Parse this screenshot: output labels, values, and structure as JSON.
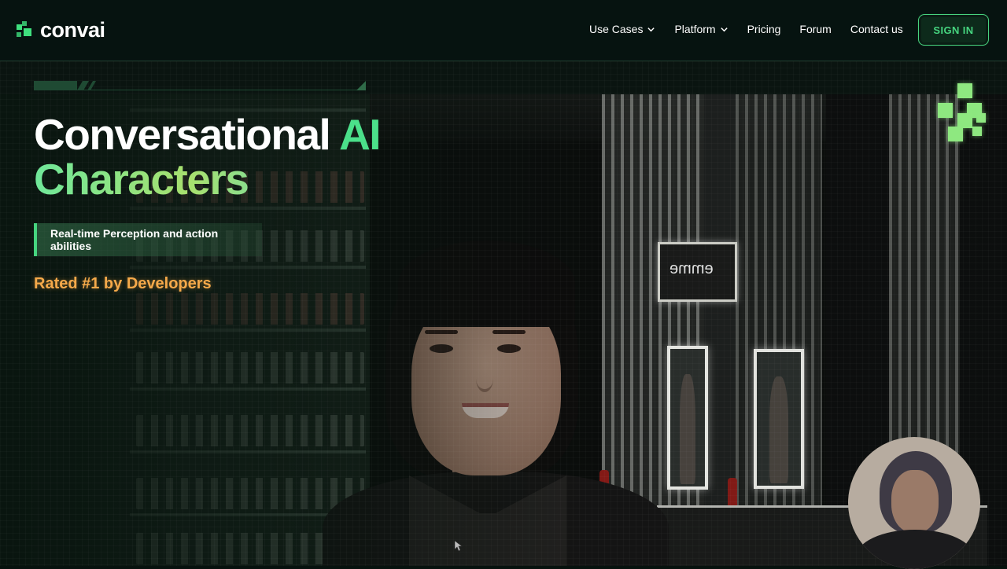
{
  "brand": {
    "name": "convai",
    "accent": "#3fe07e"
  },
  "nav": {
    "items": [
      {
        "label": "Use Cases",
        "has_dropdown": true
      },
      {
        "label": "Platform",
        "has_dropdown": true
      },
      {
        "label": "Pricing",
        "has_dropdown": false
      },
      {
        "label": "Forum",
        "has_dropdown": false
      },
      {
        "label": "Contact us",
        "has_dropdown": false
      }
    ],
    "signin_label": "SIGN IN"
  },
  "hero": {
    "title_part1": "Conversational ",
    "title_part2": "AI",
    "title_line2": "Characters",
    "feature_text": "Real-time Perception and action abilities",
    "rated_text": "Rated #1 by Developers",
    "rated_color": "#f5a94a"
  },
  "scene": {
    "sign_text": "emme",
    "icons": [
      "pixel-logo-icon",
      "chevron-down-icon",
      "cursor-icon"
    ]
  }
}
